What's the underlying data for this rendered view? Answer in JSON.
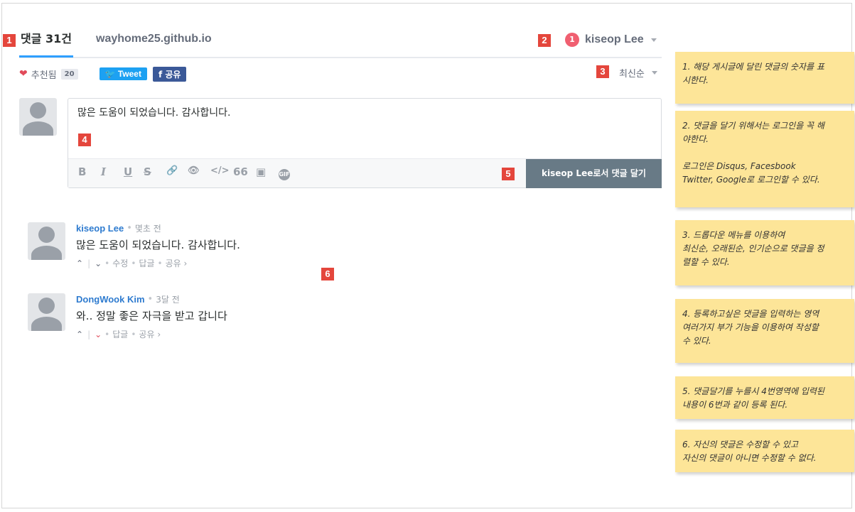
{
  "header": {
    "comment_count_tab": "댓글 31건",
    "site_tab": "wayhome25.github.io",
    "notification_count": "1",
    "user_name": "kiseop Lee"
  },
  "actions": {
    "recommend_label": "추천됨",
    "recommend_count": "20",
    "tweet_label": "Tweet",
    "share_label": "f 공유",
    "sort_label": "최신순"
  },
  "editor": {
    "text": "많은 도움이 되었습니다. 감사합니다.",
    "post_button": "kiseop Lee로서 댓글 달기",
    "tools": [
      "B",
      "I",
      "U",
      "S",
      "🔗",
      "👁",
      "</>",
      "66",
      "▣",
      "GIF"
    ]
  },
  "comments": [
    {
      "author": "kiseop Lee",
      "time": "몇초 전",
      "text": "많은 도움이 되었습니다. 감사합니다.",
      "actions": [
        "수정",
        "답글",
        "공유 ›"
      ]
    },
    {
      "author": "DongWook Kim",
      "time": "3달 전",
      "text": "와.. 정말 좋은 자극을 받고 갑니다",
      "actions": [
        "답글",
        "공유 ›"
      ]
    }
  ],
  "markers": [
    "1",
    "2",
    "3",
    "4",
    "5",
    "6"
  ],
  "notes": [
    "1. 해당 게시글에  달린 댓글의 숫자를 표\n시한다.",
    "2.  댓글을 달기 위해서는 로그인을 꼭 해\n야한다.\n\n로그인은 Disqus, Facesbook\nTwitter, Google로 로그인할 수 있다.",
    "3. 드롭다운 메뉴를 이용하여\n최신순, 오래된순, 인기순으로 댓글을 정\n렬할 수 있다.",
    "4. 등록하고싶은 댓글을 입력하는 영역\n 여러가지 부가 기능을 이용하여 작성할\n 수 있다.",
    "5. 댓글달기를 누를시  4번영역에 입력된\n 내용이 6번과 같이 등록 된다.",
    "6. 자신의 댓글은 수정할 수 있고\n자신의 댓글이 아니면 수정할 수 없다."
  ],
  "colors": {
    "accent_blue": "#2e9fff",
    "marker_red": "#e4463c",
    "sticky_yellow": "#fde598",
    "author_blue": "#2e7bcf"
  }
}
